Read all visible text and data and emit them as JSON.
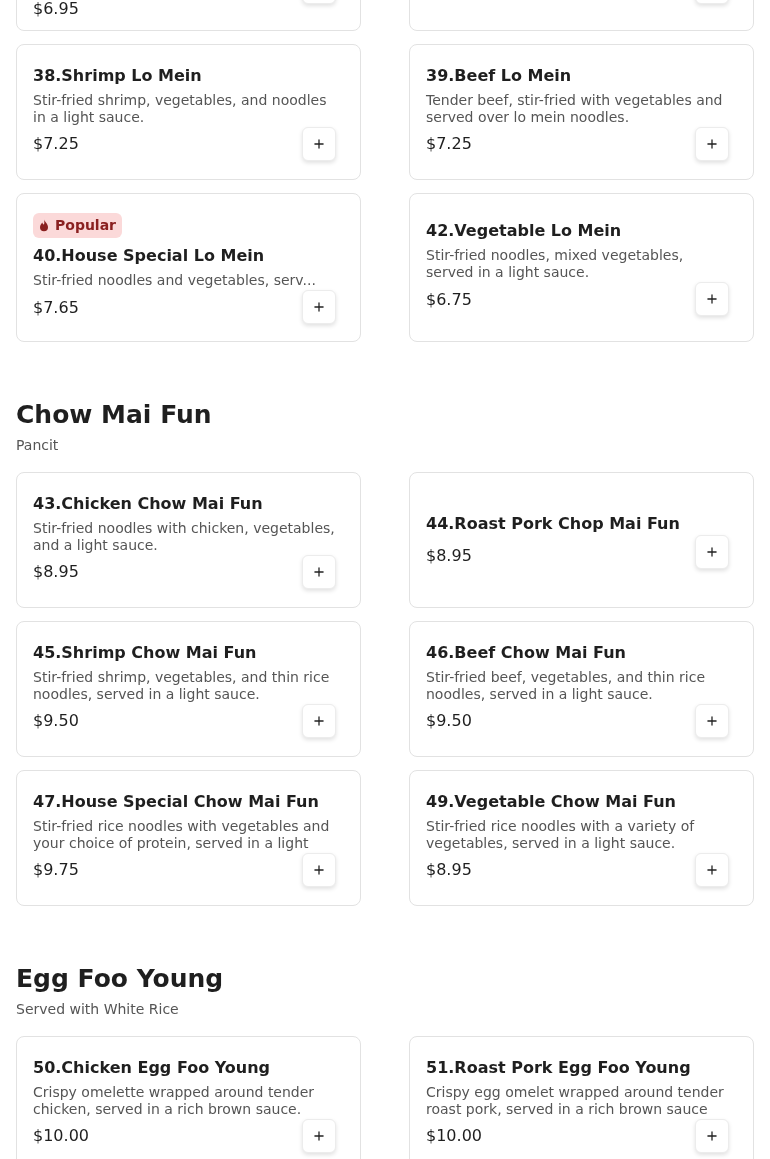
{
  "sections": [
    {
      "items": [
        {
          "kind": "cut_off",
          "price": "$6.95"
        },
        {
          "kind": "cut_off"
        },
        {
          "kind": "dish",
          "name": "38.Shrimp Lo Mein",
          "description": "Stir-fried shrimp, vegetables, and noodles in a light sauce.",
          "price": "$7.25"
        },
        {
          "kind": "dish",
          "name": "39.Beef Lo Mein",
          "description": "Tender beef, stir-fried with vegetables and served over lo mein noodles.",
          "price": "$7.25"
        },
        {
          "kind": "dish",
          "badge": "Popular",
          "name": "40.House Special Lo Mein",
          "description": "Stir-fried noodles and vegetables, serv...",
          "price": "$7.65"
        },
        {
          "kind": "dish",
          "name": "42.Vegetable Lo Mein",
          "description": "Stir-fried noodles, mixed vegetables, served in a light sauce.",
          "price": "$6.75"
        }
      ]
    },
    {
      "title": "Chow Mai Fun",
      "subtitle": "Pancit",
      "items": [
        {
          "kind": "dish",
          "name": "43.Chicken Chow Mai Fun",
          "description": "Stir-fried noodles with chicken, vegetables, and a light sauce.",
          "price": "$8.95"
        },
        {
          "kind": "dish",
          "name": "44.Roast Pork Chop Mai Fun",
          "price": "$8.95"
        },
        {
          "kind": "dish",
          "name": "45.Shrimp Chow Mai Fun",
          "description": "Stir-fried shrimp, vegetables, and thin rice noodles, served in a light sauce.",
          "price": "$9.50"
        },
        {
          "kind": "dish",
          "name": "46.Beef Chow Mai Fun",
          "description": "Stir-fried beef, vegetables, and thin rice noodles, served in a light sauce.",
          "price": "$9.50"
        },
        {
          "kind": "dish",
          "name": "47.House Special Chow Mai Fun",
          "description": "Stir-fried rice noodles with vegetables and your choice of protein, served in a light",
          "price": "$9.75"
        },
        {
          "kind": "dish",
          "name": "49.Vegetable Chow Mai Fun",
          "description": "Stir-fried rice noodles with a variety of vegetables, served in a light sauce.",
          "price": "$8.95"
        }
      ]
    },
    {
      "title": "Egg Foo Young",
      "subtitle": "Served with White Rice",
      "items": [
        {
          "kind": "dish",
          "name": "50.Chicken Egg Foo Young",
          "description": "Crispy omelette wrapped around tender chicken, served in a rich brown sauce.",
          "price": "$10.00"
        },
        {
          "kind": "dish",
          "name": "51.Roast Pork Egg Foo Young",
          "description": "Crispy egg omelet wrapped around tender roast pork, served in a rich brown sauce",
          "price": "$10.00"
        }
      ]
    }
  ]
}
